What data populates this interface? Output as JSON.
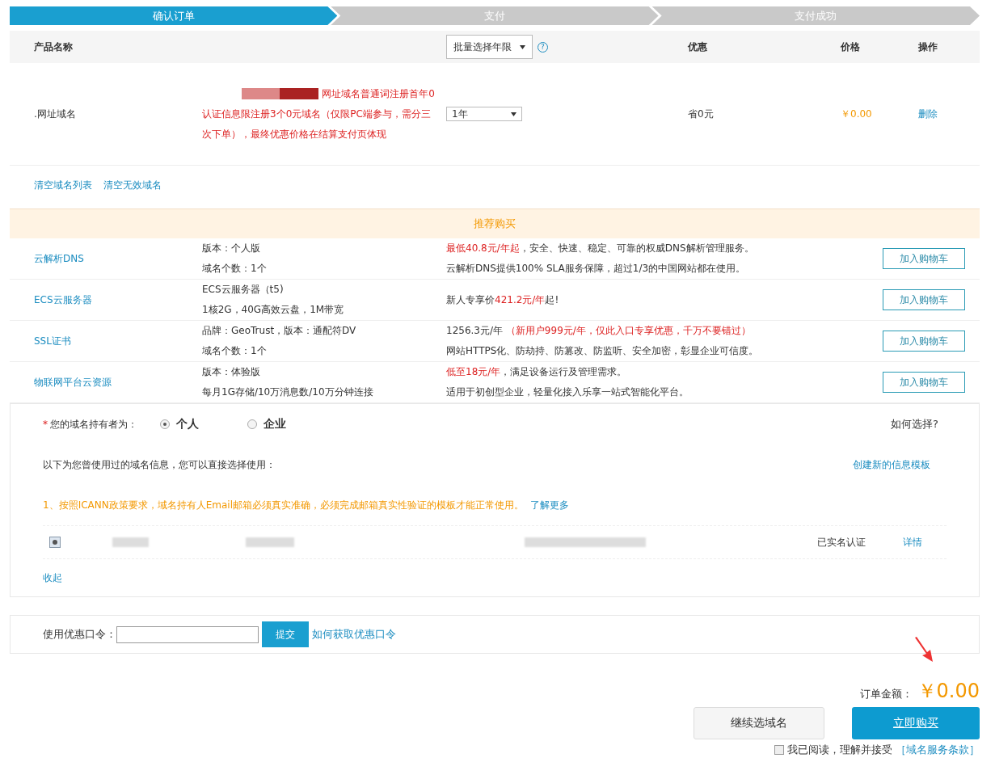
{
  "steps": [
    {
      "label": "确认订单",
      "selected": true
    },
    {
      "label": "支付",
      "selected": false
    },
    {
      "label": "支付成功",
      "selected": false
    }
  ],
  "help_icon": "?",
  "table": {
    "columns": [
      "产品名称",
      "批量选择年限",
      "优惠",
      "价格",
      "操作"
    ],
    "rows": [
      {
        "name": ".网址域名",
        "promo_line1": "网址域名普通词注册首年0",
        "promo_rest": "认证信息限注册3个0元域名（仅限PC端参与，需分三次下单），最终优惠价格在结算支付页体现",
        "period": "1年",
        "discount": "省0元",
        "price": "￥0.00",
        "action": "删除"
      }
    ]
  },
  "list_links": [
    "清空域名列表",
    "清空无效域名"
  ],
  "recommend": {
    "title": "推荐购买",
    "items": [
      {
        "name": "云解析DNS",
        "specs": [
          "版本：个人版",
          "域名个数：1个"
        ],
        "lines": [
          [
            {
              "text": "最低40.8元/年起",
              "highlight": true
            },
            {
              "text": "，安全、快速、稳定、可靠的权威DNS解析管理服务。",
              "highlight": false
            }
          ],
          [
            {
              "text": "云解析DNS提供100% SLA服务保障，超过1/3的中国网站都在使用。",
              "highlight": false
            }
          ]
        ],
        "button": "加入购物车"
      },
      {
        "name": "ECS云服务器",
        "specs": [
          "ECS云服务器（t5)",
          "1核2G，40G高效云盘，1M带宽"
        ],
        "lines": [
          [
            {
              "text": "新人专享价",
              "highlight": false
            },
            {
              "text": "421.2元/年",
              "highlight": true
            },
            {
              "text": "起!",
              "highlight": false
            }
          ]
        ],
        "button": "加入购物车"
      },
      {
        "name": "SSL证书",
        "specs": [
          "品牌：GeoTrust，版本：通配符DV",
          "域名个数：1个"
        ],
        "lines": [
          [
            {
              "text": "1256.3元/年 ",
              "highlight": false
            },
            {
              "text": "（新用户999元/年，仅此入口专享优惠，千万不要错过）",
              "highlight": true
            }
          ],
          [
            {
              "text": "网站HTTPS化、防劫持、防篡改、防监听、安全加密，彰显企业可信度。",
              "highlight": false
            }
          ]
        ],
        "button": "加入购物车"
      },
      {
        "name": "物联网平台云资源",
        "specs": [
          "版本：体验版",
          "每月1G存储/10万消息数/10万分钟连接"
        ],
        "lines": [
          [
            {
              "text": "低至18元/年",
              "highlight": true
            },
            {
              "text": "，满足设备运行及管理需求。",
              "highlight": false
            }
          ],
          [
            {
              "text": "适用于初创型企业，轻量化接入乐享一站式智能化平台。",
              "highlight": false
            }
          ]
        ],
        "button": "加入购物车"
      }
    ]
  },
  "holder": {
    "required_mark": "*",
    "label": "您的域名持有者为：",
    "options": [
      {
        "label": "个人",
        "selected": true
      },
      {
        "label": "企业",
        "selected": false
      }
    ],
    "help": "如何选择?",
    "intro": "以下为您曾使用过的域名信息，您可以直接选择使用：",
    "create_link": "创建新的信息模板",
    "notice": "1、按照ICANN政策要求，域名持有人Email邮箱必须真实准确，必须完成邮箱真实性验证的模板才能正常使用。",
    "notice_link": "了解更多",
    "templates": [
      {
        "selected": true,
        "status": "已实名认证",
        "detail": "详情"
      }
    ],
    "collapse": "收起"
  },
  "coupon": {
    "label": "使用优惠口令：",
    "button": "提交",
    "help": "如何获取优惠口令"
  },
  "total": {
    "label": "订单金额：",
    "amount": "￥0.00"
  },
  "buttons": {
    "continue": "继续选域名",
    "buy": "立即购买"
  },
  "agreement": {
    "checked": false,
    "text": "我已阅读，理解并接受",
    "link": "［域名服务条款］"
  }
}
